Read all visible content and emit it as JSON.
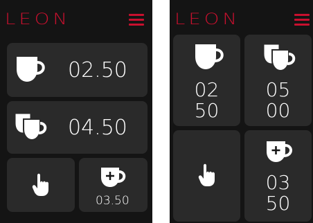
{
  "brand": {
    "logo_text": "LEON",
    "accent_color": "#c8102e"
  },
  "layout_a": {
    "tiles": [
      {
        "id": "single",
        "icon": "single-cup-icon",
        "price": "02.50"
      },
      {
        "id": "double",
        "icon": "double-cup-icon",
        "price": "04.50"
      },
      {
        "id": "touch",
        "icon": "hand-pointer-icon"
      },
      {
        "id": "plus",
        "icon": "cup-plus-icon",
        "price": "03.50"
      }
    ]
  },
  "layout_b": {
    "tiles": [
      {
        "id": "single",
        "icon": "single-cup-icon",
        "price_top": "02",
        "price_bottom": "50"
      },
      {
        "id": "double",
        "icon": "double-cup-icon",
        "price_top": "05",
        "price_bottom": "00"
      },
      {
        "id": "touch",
        "icon": "hand-pointer-icon"
      },
      {
        "id": "plus",
        "icon": "cup-plus-icon",
        "price_top": "03",
        "price_bottom": "50"
      }
    ]
  }
}
